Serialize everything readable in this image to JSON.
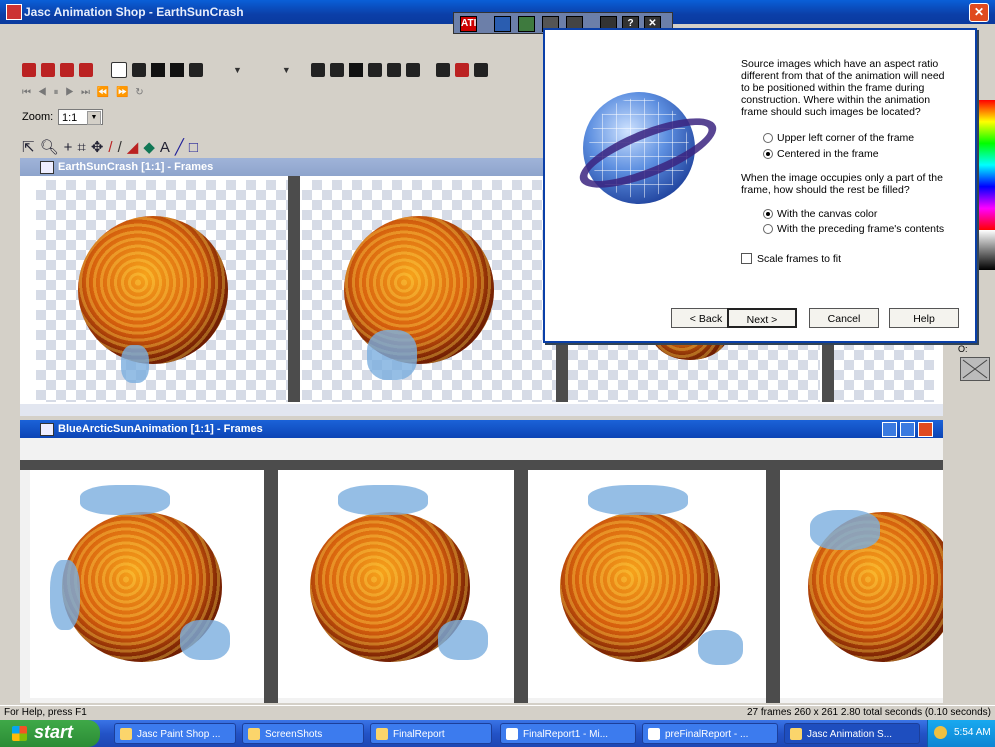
{
  "app": {
    "title": "Jasc Animation Shop - EarthSunCrash",
    "close_glyph": "✕",
    "nav_glyphs": "⏮ ◀   ⏸   ▶ ⏭  ⏪ ⏩  ↻"
  },
  "toolbar": {
    "zoom_label": "Zoom:",
    "zoom_value": "1:1"
  },
  "panes": {
    "top": {
      "title": "EarthSunCrash [1:1] - Frames"
    },
    "bottom": {
      "title": "BlueArcticSunAnimation [1:1] - Frames"
    }
  },
  "dialog": {
    "strip_icons": [
      "ATI",
      "",
      "",
      "",
      "",
      "?",
      "✕"
    ],
    "question1": "Source images which have an aspect ratio different from that of the animation will need to be positioned within the frame during construction. Where within the animation frame should such images be located?",
    "option_upper_left": "Upper left corner of the frame",
    "option_centered": "Centered in the frame",
    "question2": "When the image occupies only a part of the frame, how should the rest be filled?",
    "option_canvas": "With the canvas color",
    "option_preceding": "With the preceding frame's contents",
    "scale_label": "Scale frames to fit",
    "buttons": {
      "back": "< Back",
      "next": "Next >",
      "cancel": "Cancel",
      "help": "Help"
    }
  },
  "status": {
    "left": "For Help, press F1",
    "right": "27 frames   260 x 261   2.80 total seconds   (0.10 seconds)"
  },
  "taskbar": {
    "start": "start",
    "items": [
      "Jasc Paint Shop ...",
      "ScreenShots",
      "FinalReport",
      "FinalReport1 - Mi...",
      "preFinalReport - ...",
      "Jasc Animation S..."
    ],
    "clock": "5:54 AM"
  },
  "palette": {
    "label": "O:"
  }
}
